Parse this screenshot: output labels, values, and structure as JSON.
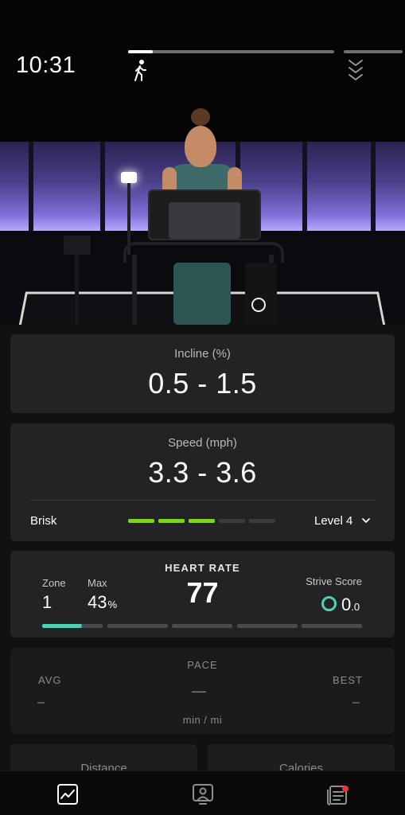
{
  "status": {
    "time": "10:31"
  },
  "class_progress": {
    "fraction": 0.12
  },
  "incline": {
    "label": "Incline (%)",
    "value": "0.5 - 1.5"
  },
  "speed": {
    "label": "Speed (mph)",
    "value": "3.3 - 3.6",
    "pace_name": "Brisk",
    "level_label": "Level 4",
    "level_filled": 3,
    "level_total": 5,
    "active_color": "#7dd321",
    "inactive_color": "#3b3b3f"
  },
  "heart_rate": {
    "title": "HEART RATE",
    "value": "77",
    "zone_label": "Zone",
    "zone_value": "1",
    "max_label": "Max",
    "max_value": "43",
    "max_unit": "%",
    "strive_label": "Strive Score",
    "strive_int": "0",
    "strive_dec": ".0",
    "zone_color": "#4fd1b5",
    "zone1_fill": 0.65
  },
  "pace": {
    "title": "PACE",
    "avg_label": "AVG",
    "best_label": "BEST",
    "avg_value": "–",
    "current_value": "—",
    "best_value": "–",
    "unit": "min / mi"
  },
  "bottom_cards": {
    "left_label": "Distance",
    "right_label": "Calories"
  },
  "tabs": [
    {
      "name": "stats-icon"
    },
    {
      "name": "instructor-video-icon"
    },
    {
      "name": "notes-icon",
      "has_notification": true
    }
  ]
}
